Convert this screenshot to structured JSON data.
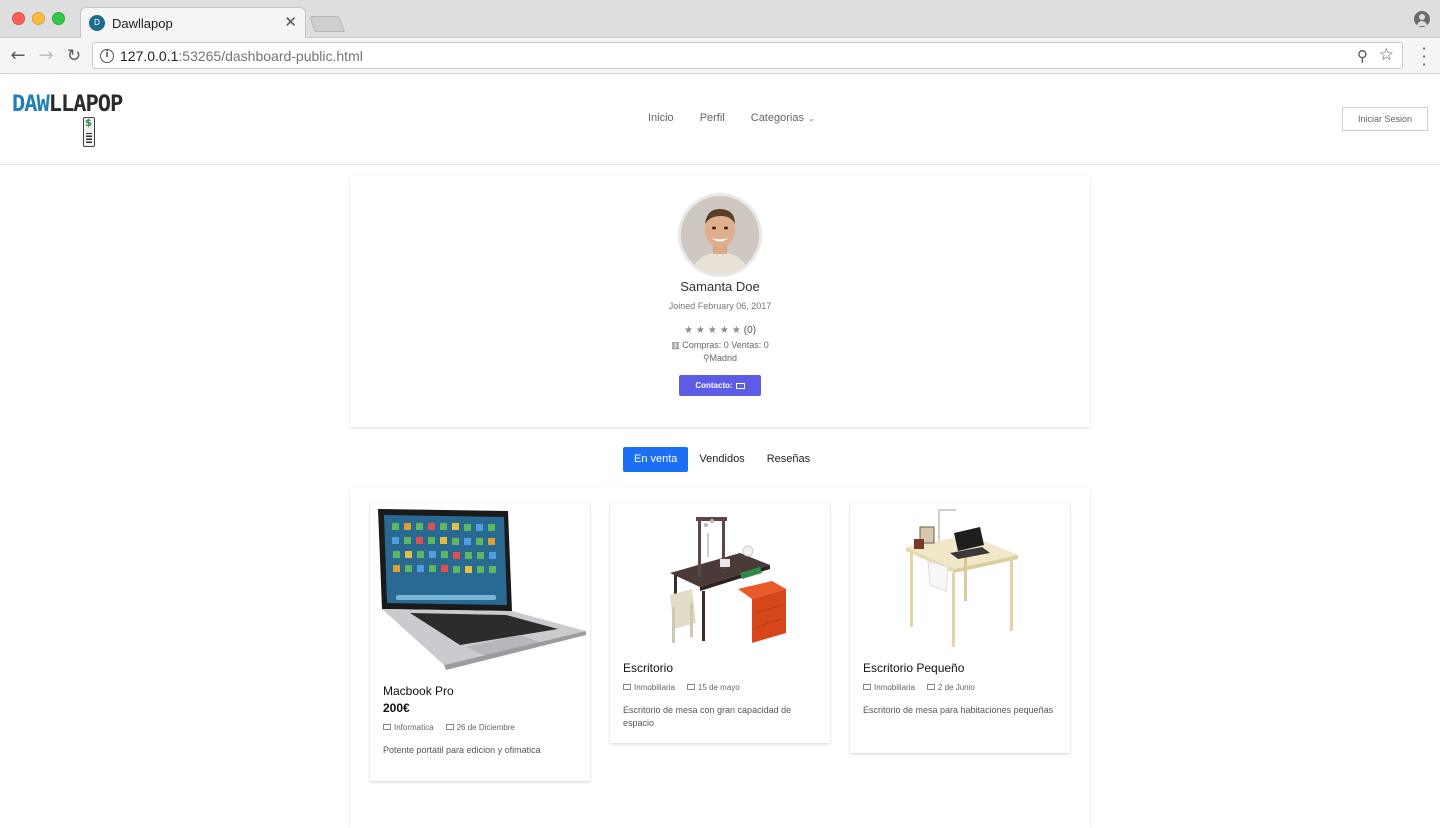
{
  "browser": {
    "tab_title": "Dawllapop",
    "url_host": "127.0.0.1",
    "url_rest": ":53265/dashboard-public.html"
  },
  "site": {
    "logo_text_a": "DAW",
    "logo_text_b": "LLAPOP",
    "nav": [
      "Inicio",
      "Perfil",
      "Categorias"
    ],
    "login_label": "Iniciar Sesion",
    "brand_color": "#1f7fb8"
  },
  "profile": {
    "name": "Samanta Doe",
    "joined": "Joined February 06, 2017",
    "stars": "★★★★★",
    "rating_count": "(0)",
    "stats": "Compras: 0 Ventas: 0",
    "location": "Madrid",
    "contact_label": "Contacto:",
    "contact_color": "#5c5ce6"
  },
  "tabs": [
    {
      "label": "En venta",
      "active": true
    },
    {
      "label": "Vendidos",
      "active": false
    },
    {
      "label": "Reseñas",
      "active": false
    }
  ],
  "products": [
    {
      "title": "Macbook Pro",
      "price": "200€",
      "category": "Informatica",
      "date": "26 de Diciembre",
      "description": "Potente portatil para edicion y ofimatica"
    },
    {
      "title": "Escritorio",
      "category": "Inmobiliaria",
      "date": "15 de mayo",
      "description": "Escritorio de mesa con gran capacidad de espacio"
    },
    {
      "title": "Escritorio Pequeño",
      "category": "Inmobiliaria",
      "date": "2 de Junio",
      "description": "Escritorio de mesa para habitaciones pequeñas"
    }
  ]
}
